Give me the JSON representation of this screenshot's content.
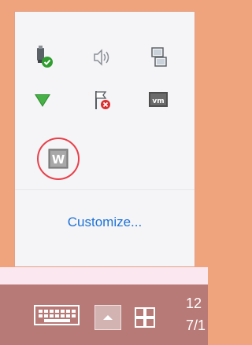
{
  "tray_flyout": {
    "icons": [
      {
        "name": "safely-remove-hardware-icon"
      },
      {
        "name": "speaker-volume-icon"
      },
      {
        "name": "network-icon"
      },
      {
        "name": "green-down-arrow-icon"
      },
      {
        "name": "action-center-flag-icon"
      },
      {
        "name": "vmware-icon"
      },
      {
        "name": "w-app-icon"
      }
    ],
    "highlight_color": "#e8404a",
    "customize_label": "Customize..."
  },
  "taskbar": {
    "buttons": [
      {
        "name": "touch-keyboard-icon"
      },
      {
        "name": "show-hidden-icons-button"
      },
      {
        "name": "windows-start-icon"
      }
    ],
    "clock_time": "12",
    "clock_date": "7/1"
  },
  "colors": {
    "background": "#f0a47e",
    "flyout_bg": "#f5f5f7",
    "link": "#1e73d6",
    "taskbar": "#b87a77"
  }
}
